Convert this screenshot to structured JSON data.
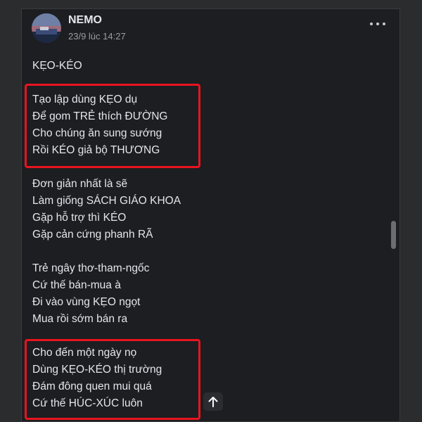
{
  "post": {
    "author": "NEMO",
    "timestamp": "23/9 lúc 14:27",
    "title": "KẸO-KÉO",
    "stanzas": [
      [
        "Tạo lập dùng KẸO dụ",
        "Để gom TRẺ thích ĐƯỜNG",
        "Cho chúng ăn sung sướng",
        "Rồi KÉO giả bộ THƯƠNG"
      ],
      [
        "Đơn giản nhất là sẽ",
        "Làm giống SÁCH GIÁO KHOA",
        "Gặp hỗ trợ thì KÉO",
        "Gặp cản cứng phanh RÃ"
      ],
      [
        "Trẻ ngây thơ-tham-ngốc",
        "Cứ thế bán-mua à",
        "Đi vào vùng KẸO ngọt",
        "Mua rồi sớm bán ra"
      ],
      [
        "Cho đến một ngày nọ",
        "Dùng KẸO-KÉO thị trường",
        "Đám đông quen mui quá",
        "Cứ thế HÚC-XÚC luôn"
      ]
    ]
  },
  "icons": {
    "more": "more-horizontal-icon",
    "scroll_top": "arrow-up-icon",
    "avatar": "profile-avatar"
  },
  "colors": {
    "background": "#1c1e21",
    "text": "#e4e6eb",
    "highlight": "#e8141f"
  }
}
